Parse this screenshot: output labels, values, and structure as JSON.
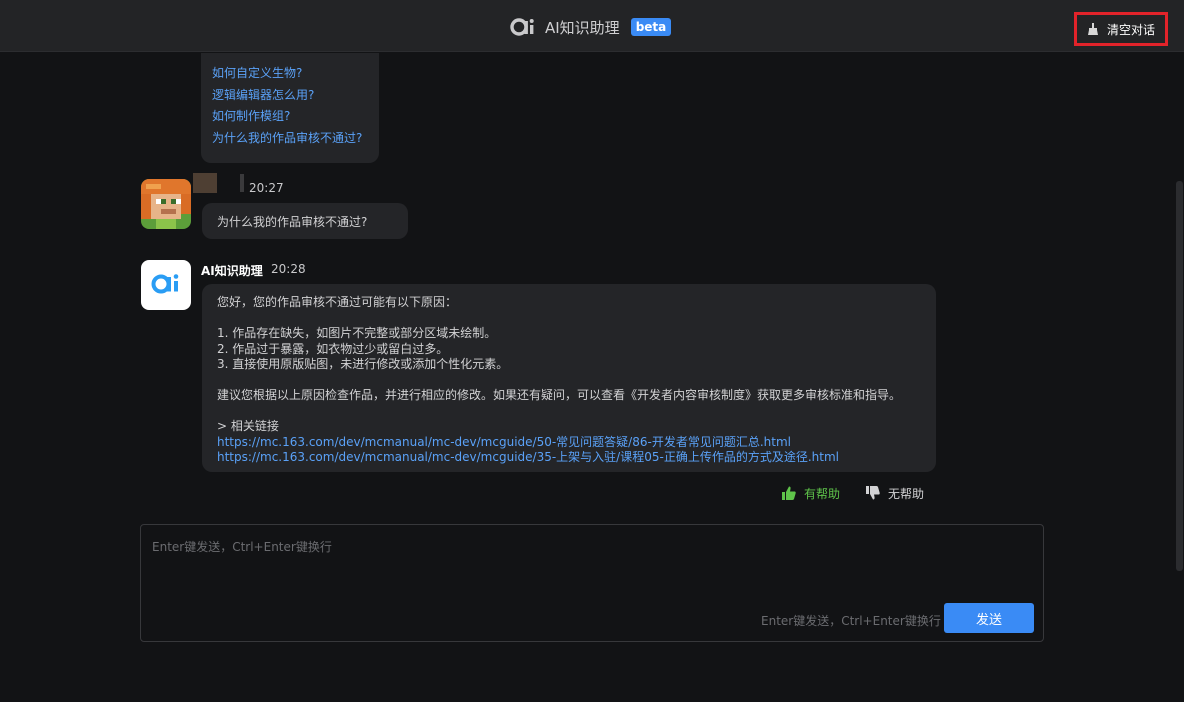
{
  "header": {
    "title": "AI知识助理",
    "badge": "beta",
    "clear_label": "清空对话"
  },
  "suggestions": [
    "如何自定义生物?",
    "逻辑编辑器怎么用?",
    "如何制作模组?",
    "为什么我的作品审核不通过?"
  ],
  "user_message": {
    "time": "20:27",
    "text": "为什么我的作品审核不通过?"
  },
  "ai_message": {
    "name": "AI知识助理",
    "time": "20:28",
    "intro": "您好，您的作品审核不通过可能有以下原因：",
    "reasons": [
      "1. 作品存在缺失，如图片不完整或部分区域未绘制。",
      "2. 作品过于暴露，如衣物过少或留白过多。",
      "3. 直接使用原版贴图，未进行修改或添加个性化元素。"
    ],
    "advice": "建议您根据以上原因检查作品，并进行相应的修改。如果还有疑问，可以查看《开发者内容审核制度》获取更多审核标准和指导。",
    "links_heading": "> 相关链接",
    "links": [
      "https://mc.163.com/dev/mcmanual/mc-dev/mcguide/50-常见问题答疑/86-开发者常见问题汇总.html",
      "https://mc.163.com/dev/mcmanual/mc-dev/mcguide/35-上架与入驻/课程05-正确上传作品的方式及途径.html"
    ]
  },
  "feedback": {
    "helpful": "有帮助",
    "unhelpful": "无帮助"
  },
  "input": {
    "placeholder": "Enter键发送，Ctrl+Enter键换行",
    "value": "",
    "hint": "Enter键发送，Ctrl+Enter键换行",
    "send_label": "发送"
  },
  "colors": {
    "accent": "#3a8bf5",
    "link": "#5aa1f7",
    "helpful": "#5fc44a",
    "highlight": "#e2232a"
  }
}
